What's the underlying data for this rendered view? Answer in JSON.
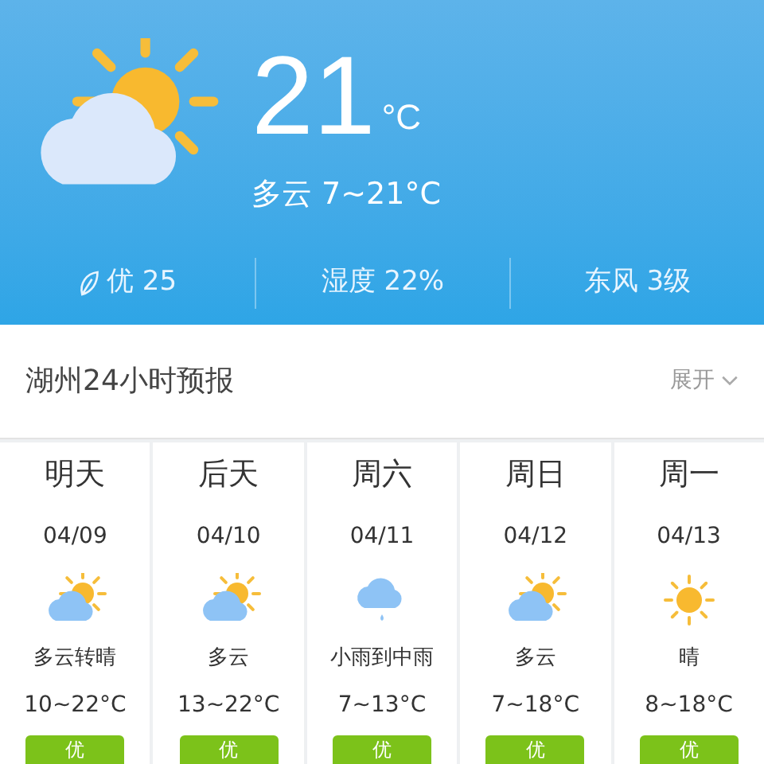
{
  "current": {
    "temperature": "21",
    "unit": "°C",
    "summary": "多云 7~21°C",
    "kind": "partly-cloudy"
  },
  "stats": [
    {
      "text": "优 25",
      "kind": "leaf"
    },
    {
      "text": "湿度 22%"
    },
    {
      "text": "东风 3级"
    }
  ],
  "hourly": {
    "title": "湖州24小时预报",
    "toggle": "展开"
  },
  "days": [
    {
      "day": "明天",
      "date": "04/09",
      "kind": "partly-cloudy",
      "weather": "多云转晴",
      "range": "10~22°C",
      "aqi": "优"
    },
    {
      "day": "后天",
      "date": "04/10",
      "kind": "partly-cloudy",
      "weather": "多云",
      "range": "13~22°C",
      "aqi": "优"
    },
    {
      "day": "周六",
      "date": "04/11",
      "kind": "rain",
      "weather": "小雨到中雨",
      "range": "7~13°C",
      "aqi": "优"
    },
    {
      "day": "周日",
      "date": "04/12",
      "kind": "partly-cloudy",
      "weather": "多云",
      "range": "7~18°C",
      "aqi": "优"
    },
    {
      "day": "周一",
      "date": "04/13",
      "kind": "sunny",
      "weather": "晴",
      "range": "8~18°C",
      "aqi": "优"
    }
  ]
}
